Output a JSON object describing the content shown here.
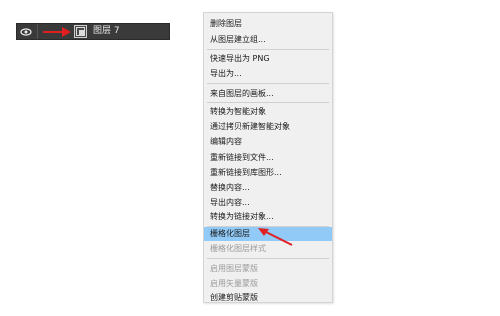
{
  "layers_panel": {
    "layer_name": "图层 7",
    "icons": {
      "visibility": "eye-icon",
      "annotation": "red-arrow-icon",
      "thumbnail": "smart-object-thumbnail-icon"
    },
    "colors": {
      "panel_bg": "#3a3a3a",
      "text": "#e8e8e8",
      "annotation_red": "#e02020"
    }
  },
  "context_menu": {
    "colors": {
      "highlight": "#91c9f7",
      "disabled_text": "#9a9a9a"
    },
    "items": [
      {
        "label": "删除图层",
        "enabled": true
      },
      {
        "label": "从图层建立组...",
        "enabled": true
      },
      {
        "label": "快速导出为 PNG",
        "enabled": true
      },
      {
        "label": "导出为...",
        "enabled": true
      },
      {
        "label": "来自图层的画板...",
        "enabled": true
      },
      {
        "label": "转换为智能对象",
        "enabled": true
      },
      {
        "label": "通过拷贝新建智能对象",
        "enabled": true
      },
      {
        "label": "编辑内容",
        "enabled": true
      },
      {
        "label": "重新链接到文件...",
        "enabled": true
      },
      {
        "label": "重新链接到库图形...",
        "enabled": true
      },
      {
        "label": "替换内容...",
        "enabled": true
      },
      {
        "label": "导出内容...",
        "enabled": true
      },
      {
        "label": "转换为链接对象...",
        "enabled": true
      },
      {
        "label": "栅格化图层",
        "enabled": true,
        "highlighted": true
      },
      {
        "label": "栅格化图层样式",
        "enabled": false
      },
      {
        "label": "启用图层蒙版",
        "enabled": false
      },
      {
        "label": "启用矢量蒙版",
        "enabled": false
      },
      {
        "label": "创建剪贴蒙版",
        "enabled": true
      }
    ]
  }
}
